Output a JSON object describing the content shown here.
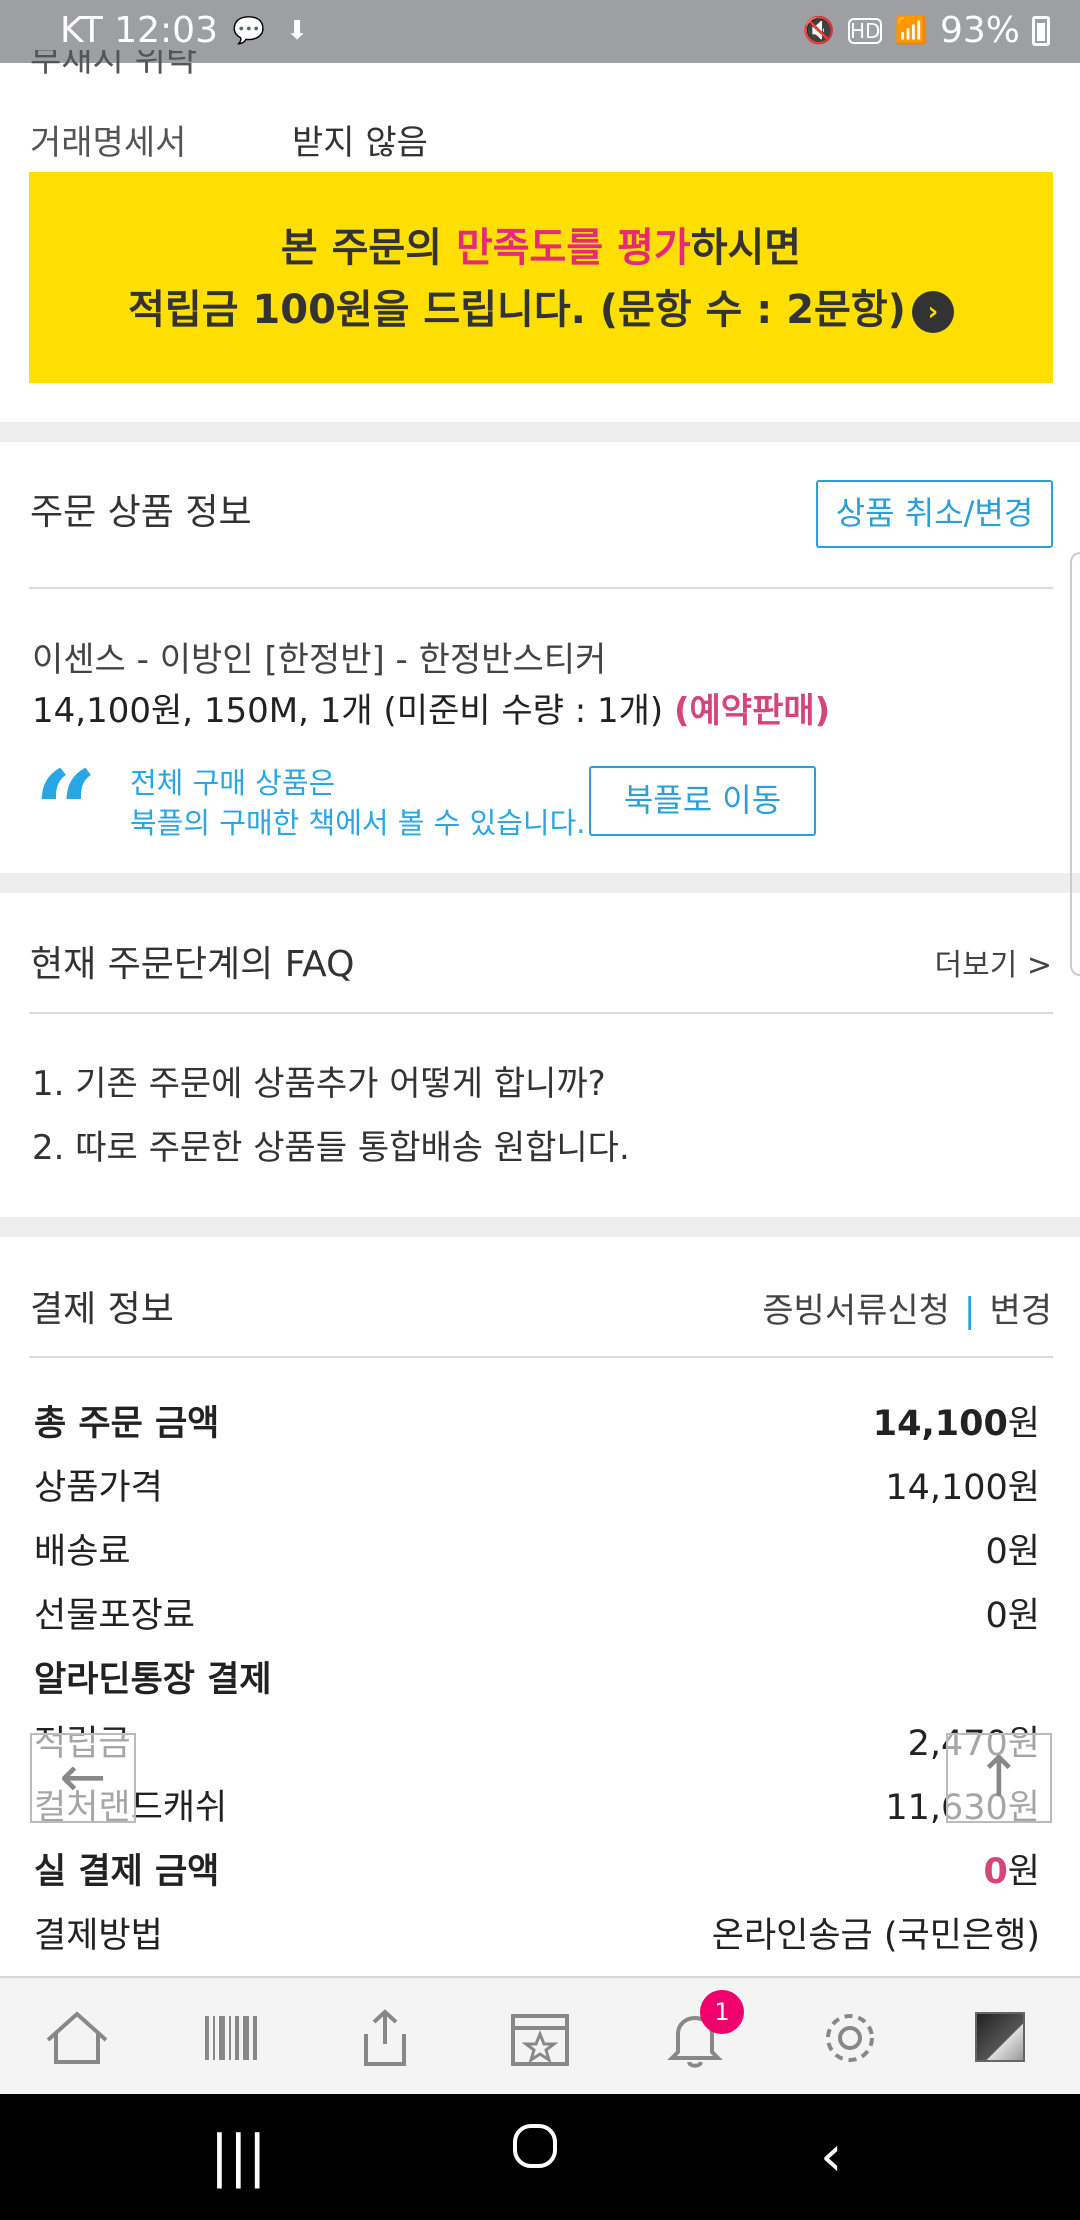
{
  "status_bar": {
    "carrier_time": "KT 12:03",
    "battery": "93%"
  },
  "top": {
    "cutoff_text": "부재시 위탁",
    "doc_label": "거래명세서",
    "doc_value": "받지 않음"
  },
  "banner": {
    "line1_a": "본 주문의 ",
    "line1_pink": "만족도를 평가",
    "line1_b": "하시면",
    "line2": "적립금 100원을 드립니다. (문항 수 : 2문항)",
    "arrow": "›"
  },
  "order_info": {
    "title": "주문 상품 정보",
    "change_button": "상품 취소/변경",
    "product_name": "이센스 - 이방인 [한정반] - 한정반스티커",
    "product_detail": "14,100원, 150M, 1개 (미준비 수량 : 1개) ",
    "product_tag": "(예약판매)",
    "bookpl_line1": "전체 구매 상품은",
    "bookpl_line2": "북플의 구매한 책에서 볼 수 있습니다.",
    "bookpl_button": "북플로 이동"
  },
  "faq": {
    "title": "현재 주문단계의 FAQ",
    "more": "더보기 >",
    "items": [
      "1. 기존 주문에 상품추가 어떻게 합니까?",
      "2. 따로 주문한 상품들 통합배송 원합니다."
    ]
  },
  "payment": {
    "title": "결제 정보",
    "link_docs": "증빙서류신청",
    "link_sep": "|",
    "link_change": "변경",
    "rows": {
      "total_label": "총 주문 금액",
      "total_value_num": "14,100",
      "total_value_unit": "원",
      "price_label": "상품가격",
      "price_value": "14,100원",
      "shipping_label": "배송료",
      "shipping_value": "0원",
      "wrap_label": "선물포장료",
      "wrap_value": "0원",
      "aladin_label": "알라딘통장 결제",
      "points_label": "적립금",
      "points_value": "2,470원",
      "cash_label": "컬처랜드캐쉬",
      "cash_value": "11,630원",
      "actual_label": "실 결제 금액",
      "actual_value_num": "0",
      "actual_value_unit": "원",
      "method_label": "결제방법",
      "method_value": "온라인송금 (국민은행)"
    }
  },
  "floating": {
    "back": "←",
    "top": "↑"
  },
  "app_bar": {
    "notification_count": "1"
  }
}
